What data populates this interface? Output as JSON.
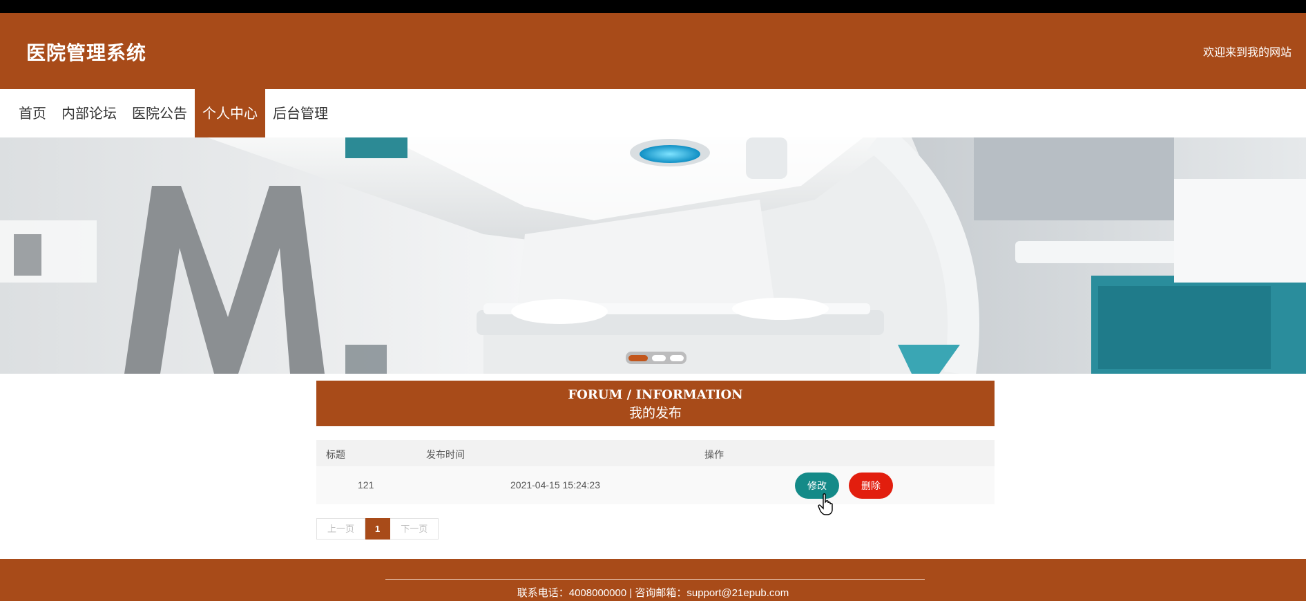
{
  "header": {
    "title": "医院管理系统",
    "welcome": "欢迎来到我的网站"
  },
  "nav": {
    "items": [
      {
        "label": "首页",
        "active": false
      },
      {
        "label": "内部论坛",
        "active": false
      },
      {
        "label": "医院公告",
        "active": false
      },
      {
        "label": "个人中心",
        "active": true
      },
      {
        "label": "后台管理",
        "active": false
      }
    ]
  },
  "banner": {
    "slides": 3,
    "active_slide": 1
  },
  "section": {
    "title_en": "FORUM / INFORMATION",
    "title_cn": "我的发布"
  },
  "table": {
    "columns": [
      "标题",
      "发布时间",
      "操作"
    ],
    "rows": [
      {
        "title": "121",
        "time": "2021-04-15 15:24:23",
        "edit_label": "修改",
        "delete_label": "删除"
      }
    ]
  },
  "pager": {
    "prev": "上一页",
    "current": "1",
    "next": "下一页"
  },
  "footer": {
    "text": "联系电话：4008000000 | 咨询邮箱：support@21epub.com"
  },
  "colors": {
    "brand": "#a84b19",
    "edit_button": "#148a88",
    "delete_button": "#e21e0e"
  }
}
